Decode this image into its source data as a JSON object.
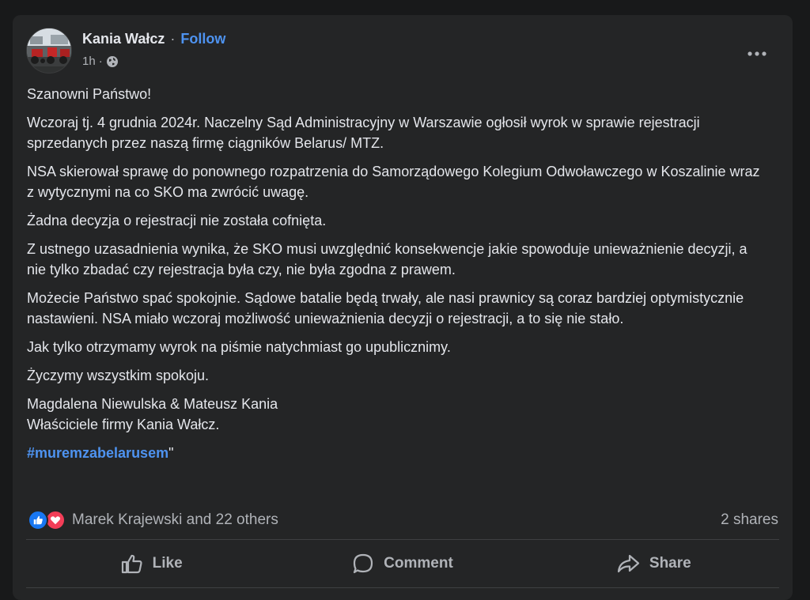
{
  "post": {
    "author": "Kania Wałcz",
    "separator": "·",
    "follow_label": "Follow",
    "time": "1h",
    "time_separator": "·",
    "audience_icon": "globe-icon",
    "more_icon": "more-horizontal-icon",
    "paragraphs": [
      "Szanowni Państwo!",
      "Wczoraj tj. 4 grudnia 2024r.  Naczelny Sąd Administracyjny w Warszawie ogłosił wyrok w sprawie rejestracji sprzedanych przez naszą firmę ciągników Belarus/ MTZ.",
      "NSA skierował sprawę do ponownego rozpatrzenia do Samorządowego Kolegium Odwoławczego w Koszalinie wraz z wytycznymi na co SKO ma zwrócić uwagę.",
      "Żadna decyzja o rejestracji nie została cofnięta.",
      "Z ustnego uzasadnienia wynika, że SKO musi uwzględnić konsekwencje jakie spowoduje unieważnienie decyzji, a nie tylko zbadać czy rejestracja była czy, nie była zgodna z prawem.",
      "Możecie Państwo spać spokojnie. Sądowe batalie będą trwały, ale nasi prawnicy są coraz bardziej optymistycznie nastawieni. NSA miało wczoraj możliwość unieważnienia decyzji o rejestracji, a to się nie stało.",
      "Jak tylko otrzymamy wyrok na piśmie natychmiast go upublicznimy.",
      "Życzymy wszystkim spokoju."
    ],
    "signature_line1": "Magdalena Niewulska & Mateusz Kania",
    "signature_line2": "Właściciele firmy Kania Wałcz.",
    "hashtag": "#muremzabelarusem",
    "hashtag_suffix": "\""
  },
  "engagement": {
    "reactions_text": "Marek Krajewski and 22 others",
    "shares_text": "2 shares",
    "reaction_icons": [
      "like-reaction-icon",
      "love-reaction-icon"
    ]
  },
  "actions": {
    "like_label": "Like",
    "comment_label": "Comment",
    "share_label": "Share"
  },
  "colors": {
    "background": "#18191a",
    "card": "#242526",
    "text_primary": "#e4e6eb",
    "text_secondary": "#b0b3b8",
    "link": "#4e93f0",
    "like_blue": "#1877f2",
    "love_red": "#f33e58"
  }
}
